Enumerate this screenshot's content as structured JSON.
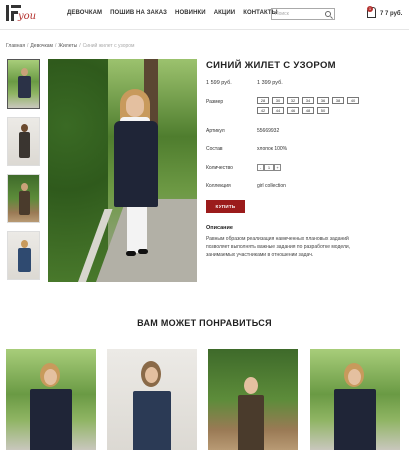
{
  "header": {
    "logo_text": "you",
    "nav": [
      "ДЕВОЧКАМ",
      "ПОШИВ НА ЗАКАЗ",
      "НОВИНКИ",
      "АКЦИИ",
      "КОНТАКТЫ"
    ],
    "search_placeholder": "Поиск",
    "cart_count": "1",
    "cart_total": "7 7 руб."
  },
  "breadcrumb": {
    "items": [
      "Главная",
      "Девочкам",
      "Жилеты"
    ],
    "current": "Синий жилет с узором",
    "separator": "/"
  },
  "product": {
    "title": "СИНИЙ ЖИЛЕТ С УЗОРОМ",
    "old_price": "1 599 руб.",
    "price": "1 399 руб.",
    "size_label": "Размер",
    "sizes": [
      "28",
      "30",
      "32",
      "34",
      "36",
      "38",
      "40",
      "42",
      "44",
      "46",
      "48",
      "50"
    ],
    "article_label": "Артикул",
    "article": "55669932",
    "composition_label": "Состав",
    "composition": "хлопок 100%",
    "quantity_label": "Количество",
    "quantity": "1",
    "qty_minus": "-",
    "qty_plus": "+",
    "collection_label": "Коллекция",
    "collection": "girl collection",
    "buy_label": "КУПИТЬ",
    "description_label": "Описание",
    "description": "Равным образом реализация намеченных плановых заданий позволяет выполнять важные задания по разработке модели, занимаемых участниками в отношении задач."
  },
  "recommendations": {
    "title": "ВАМ МОЖЕТ ПОНРАВИТЬСЯ"
  },
  "colors": {
    "accent": "#9b1b1b",
    "logo": "#b4322f"
  }
}
